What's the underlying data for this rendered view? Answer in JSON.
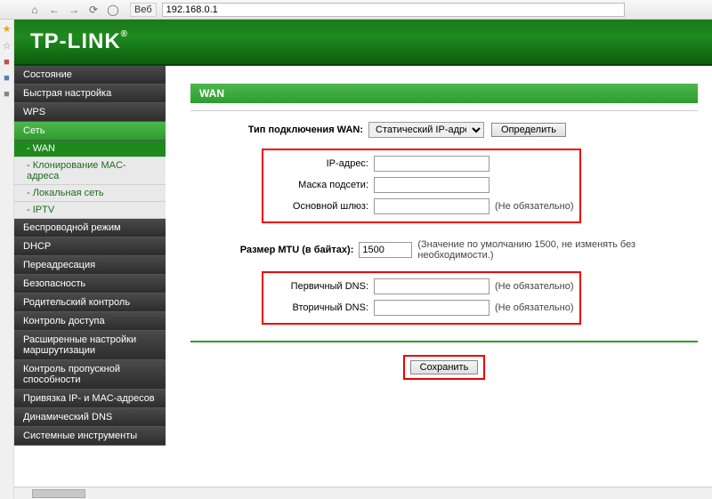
{
  "browser": {
    "addr_label": "Веб",
    "url": "192.168.0.1"
  },
  "brand": "TP-LINK",
  "nav": {
    "items": [
      {
        "label": "Состояние"
      },
      {
        "label": "Быстрая настройка"
      },
      {
        "label": "WPS"
      },
      {
        "label": "Сеть",
        "active": true
      },
      {
        "label": "Беспроводной режим"
      },
      {
        "label": "DHCP"
      },
      {
        "label": "Переадресация"
      },
      {
        "label": "Безопасность"
      },
      {
        "label": "Родительский контроль"
      },
      {
        "label": "Контроль доступа"
      },
      {
        "label": "Расширенные настройки маршрутизации"
      },
      {
        "label": "Контроль пропускной способности"
      },
      {
        "label": "Привязка IP- и МАС-адресов"
      },
      {
        "label": "Динамический DNS"
      },
      {
        "label": "Системные инструменты"
      }
    ],
    "subs": [
      {
        "label": "- WAN",
        "active": true
      },
      {
        "label": "- Клонирование MAC-адреса"
      },
      {
        "label": "- Локальная сеть"
      },
      {
        "label": "- IPTV"
      }
    ]
  },
  "page_title": "WAN",
  "conn_type_label": "Тип подключения WAN:",
  "conn_type_value": "Статический IP-адрес",
  "detect_btn": "Определить",
  "ip_label": "IP-адрес:",
  "mask_label": "Маска подсети:",
  "gateway_label": "Основной шлюз:",
  "optional": "(Не обязательно)",
  "mtu_label": "Размер MTU (в байтах):",
  "mtu_value": "1500",
  "mtu_hint": "(Значение по умолчанию 1500, не изменять без необходимости.)",
  "dns1_label": "Первичный DNS:",
  "dns2_label": "Вторичный DNS:",
  "save_btn": "Сохранить"
}
